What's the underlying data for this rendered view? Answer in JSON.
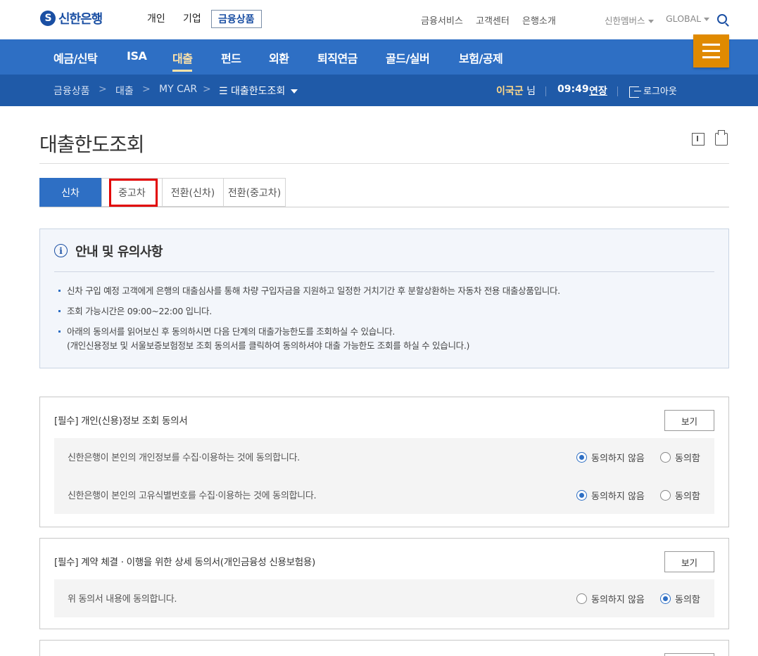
{
  "header": {
    "logo_text": "신한은행",
    "segments": [
      "개인",
      "기업",
      "금융상품"
    ],
    "util_links": [
      "금융서비스",
      "고객센터",
      "은행소개"
    ],
    "members": "신한멤버스",
    "global": "GLOBAL"
  },
  "main_nav": [
    "예금/신탁",
    "ISA",
    "대출",
    "펀드",
    "외환",
    "퇴직연금",
    "골드/실버",
    "보험/공제"
  ],
  "breadcrumb": {
    "items": [
      "금융상품",
      "대출",
      "MY CAR"
    ],
    "current": "대출한도조회",
    "separator": ">"
  },
  "session": {
    "user_name": "이국군",
    "honorific": "님",
    "time": "09:49",
    "extend_label": "연장",
    "logout_label": "로그아웃"
  },
  "page": {
    "title": "대출한도조회"
  },
  "tabs": [
    "신차",
    "중고차",
    "전환(신차)",
    "전환(중고차)"
  ],
  "notice": {
    "icon_glyph": "i",
    "title": "안내 및 유의사항",
    "bullets": [
      "신차 구입 예정 고객에게 은행의 대출심사를 통해 차량 구입자금을 지원하고 일정한 거치기간 후 분할상환하는 자동차 전용 대출상품입니다.",
      "조회 가능시간은 09:00~22:00 입니다.",
      "아래의 동의서를 읽어보신 후 동의하시면 다음 단계의 대출가능한도를 조회하실 수 있습니다."
    ],
    "bullet3_sub": "(개인신용정보 및 서울보증보험정보 조회 동의서를 클릭하여 동의하셔야 대출 가능한도 조회를 하실 수 있습니다.)"
  },
  "consents": [
    {
      "title": "[필수] 개인(신용)정보 조회 동의서",
      "view_label": "보기",
      "rows": [
        {
          "text": "신한은행이 본인의 개인정보를 수집·이용하는 것에 동의합니다.",
          "disagree": "동의하지 않음",
          "agree": "동의함",
          "selected": "disagree"
        },
        {
          "text": "신한은행이 본인의 고유식별번호를 수집·이용하는 것에 동의합니다.",
          "disagree": "동의하지 않음",
          "agree": "동의함",
          "selected": "disagree"
        }
      ]
    },
    {
      "title": "[필수] 계약 체결 · 이행을 위한 상세 동의서(개인금융성 신용보험용)",
      "view_label": "보기",
      "rows": [
        {
          "text": "위 동의서 내용에 동의합니다.",
          "disagree": "동의하지 않음",
          "agree": "동의함",
          "selected": "agree"
        }
      ]
    }
  ],
  "colors": {
    "primary_blue": "#2e6fc4",
    "dark_blue": "#1f5aa8",
    "menu_orange": "#e08a00",
    "highlight_red": "#e20000"
  }
}
